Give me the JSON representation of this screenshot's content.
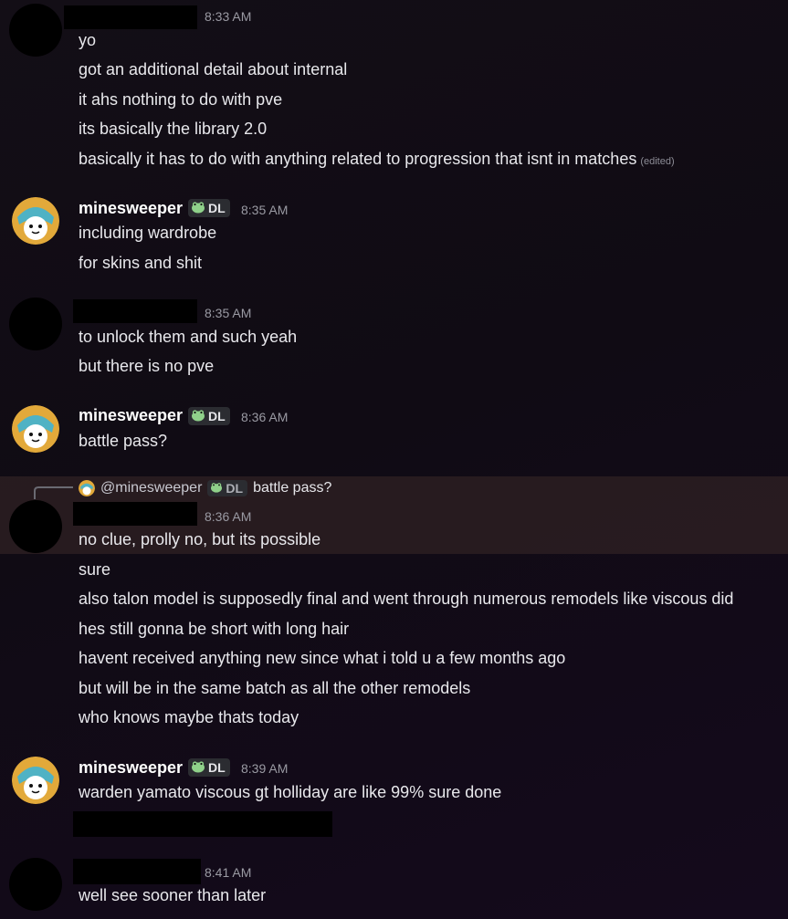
{
  "messages": [
    {
      "time": "8:33 AM",
      "lines": [
        "yo",
        "got an additional detail about internal",
        "it ahs nothing to do with pve",
        "its basically the library 2.0",
        "basically it has to do with anything related to progression that isnt in matches"
      ],
      "edited": "(edited)"
    },
    {
      "author": "minesweeper",
      "badge": "DL",
      "time": "8:35 AM",
      "lines": [
        "including wardrobe",
        "for skins and shit"
      ]
    },
    {
      "time": "8:35 AM",
      "lines": [
        "to unlock them and such yeah",
        "but there is no pve"
      ]
    },
    {
      "author": "minesweeper",
      "badge": "DL",
      "time": "8:36 AM",
      "lines": [
        "battle pass?"
      ]
    },
    {
      "reply": {
        "mention": "@minesweeper",
        "badge": "DL",
        "text": "battle pass?"
      },
      "time": "8:36 AM",
      "lines": [
        "no clue, prolly no, but its possible",
        "sure",
        "also talon model is supposedly final and went through numerous remodels like viscous did",
        "hes still gonna be short with long hair",
        "havent received anything new since what i told u a few months ago",
        "but will be in the same batch as all the other remodels",
        "who knows maybe thats today"
      ]
    },
    {
      "author": "minesweeper",
      "badge": "DL",
      "time": "8:39 AM",
      "lines": [
        "warden yamato viscous gt holliday are like 99% sure done"
      ]
    },
    {
      "time": "8:41 AM",
      "lines": [
        "well see sooner than later"
      ]
    }
  ],
  "icons": {
    "badge": "frog-icon",
    "avatar": "anime-girl-avatar"
  },
  "colors": {
    "background": "#120d17",
    "highlight": "#3a2a28",
    "badge_bg": "#2b2c31",
    "timestamp": "#9a9aa3"
  }
}
